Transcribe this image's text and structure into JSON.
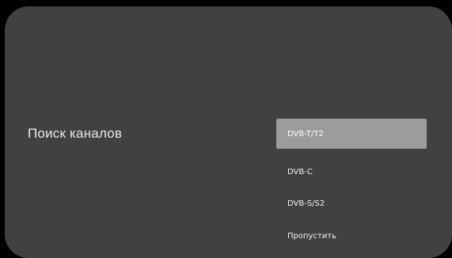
{
  "screen": {
    "title": "Поиск каналов"
  },
  "menu": {
    "items": [
      {
        "label": "DVB-T/T2",
        "selected": true
      },
      {
        "label": "DVB-C",
        "selected": false
      },
      {
        "label": "DVB-S/S2",
        "selected": false
      },
      {
        "label": "Пропустить",
        "selected": false
      }
    ]
  },
  "colors": {
    "background": "#414141",
    "selected_item": "#9c9c9c",
    "text": "#f2f2f2",
    "bezel": "#000000"
  }
}
